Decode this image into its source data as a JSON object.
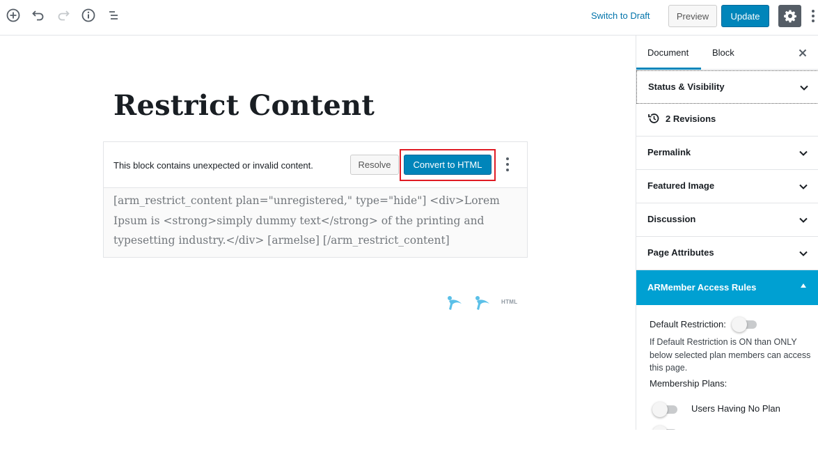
{
  "toolbar": {
    "switch_to_draft": "Switch to Draft",
    "preview": "Preview",
    "update": "Update",
    "icons": [
      "add-block-icon",
      "undo-icon",
      "redo-icon",
      "info-icon",
      "block-navigation-icon",
      "gear-icon",
      "more-vertical-icon"
    ]
  },
  "editor": {
    "title": "Restrict Content",
    "warning": {
      "message": "This block contains unexpected or invalid content.",
      "resolve": "Resolve",
      "convert": "Convert to HTML"
    },
    "raw_content": "[arm_restrict_content plan=\"unregistered,\" type=\"hide\"] <div>Lorem Ipsum is <strong>simply dummy text</strong> of the printing and typesetting industry.</div> [armelse] [/arm_restrict_content]",
    "inserter_html_label": "HTML"
  },
  "sidebar": {
    "tabs": [
      {
        "label": "Document",
        "active": true
      },
      {
        "label": "Block",
        "active": false
      }
    ],
    "panels": [
      {
        "title": "Status & Visibility"
      },
      {
        "title": "2 Revisions"
      },
      {
        "title": "Permalink"
      },
      {
        "title": "Featured Image"
      },
      {
        "title": "Discussion"
      },
      {
        "title": "Page Attributes"
      },
      {
        "title": "ARMember Access Rules"
      }
    ],
    "armember": {
      "default_restriction_label": "Default Restriction:",
      "default_restriction_on": false,
      "help_text": "If Default Restriction is ON than ONLY below selected plan members can access this page.",
      "membership_plans_label": "Membership Plans:",
      "plans": [
        {
          "label": "Users Having No Plan",
          "on": false
        }
      ]
    }
  },
  "colors": {
    "accent": "#0085ba",
    "armember_header": "#00a0d2",
    "link": "#0073aa",
    "highlight_border": "#e01b24"
  }
}
